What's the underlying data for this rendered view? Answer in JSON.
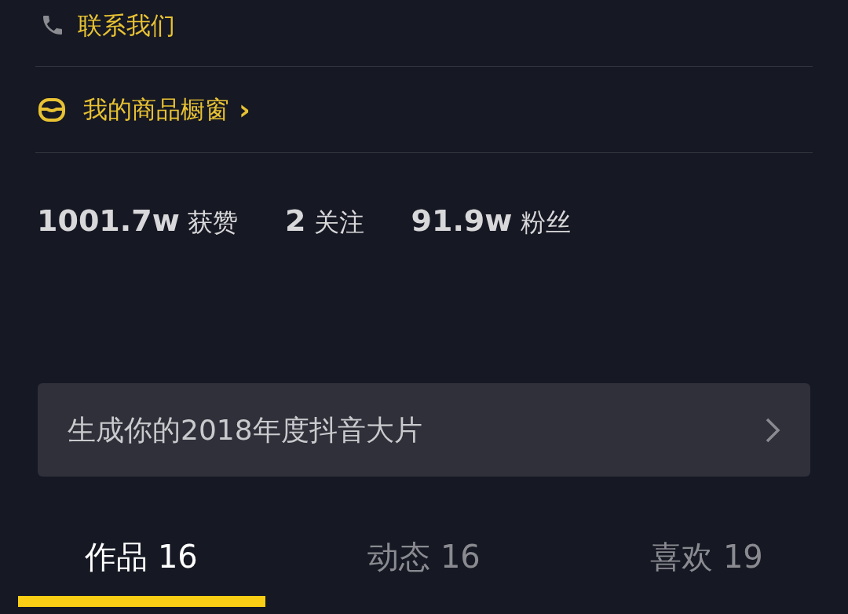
{
  "contact": {
    "label": "联系我们"
  },
  "showcase": {
    "label": "我的商品橱窗",
    "chevron": "›"
  },
  "stats": [
    "**1001.7w** 获赞",
    "**2** 关注",
    "**91.9w** 粉丝"
  ],
  "banner": {
    "label": "生成你的2018年度抖音大片"
  },
  "tabs": [
    {
      "label": "作品 16",
      "selected": true
    },
    {
      "label": "动态 16",
      "selected": false
    },
    {
      "label": "喜欢 19",
      "selected": false
    }
  ]
}
